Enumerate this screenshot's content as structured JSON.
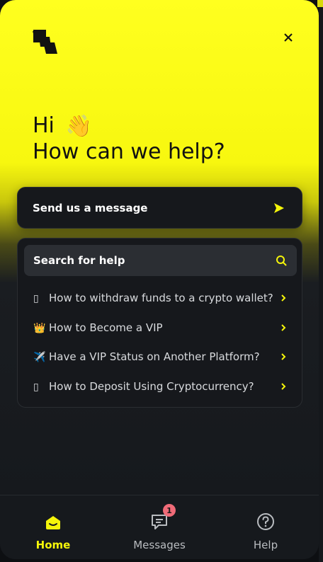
{
  "header": {
    "greeting_line1": "Hi",
    "greeting_emoji": "👋",
    "greeting_line2": "How can we help?",
    "logo_icon": "brand-logo-icon",
    "close_icon": "close-icon"
  },
  "send_message": {
    "label": "Send us a message",
    "icon": "send-arrow-icon"
  },
  "search": {
    "placeholder": "Search for help",
    "icon": "search-icon"
  },
  "articles": [
    {
      "emoji": "▯",
      "title": "How to withdraw funds to a crypto wallet?"
    },
    {
      "emoji": "👑",
      "title": "How to Become a VIP"
    },
    {
      "emoji": "✈️",
      "title": "Have a VIP Status on Another Platform?"
    },
    {
      "emoji": "▯",
      "title": "How to Deposit Using Cryptocurrency?"
    }
  ],
  "nav": {
    "home": {
      "label": "Home",
      "icon": "home-icon"
    },
    "messages": {
      "label": "Messages",
      "icon": "messages-icon",
      "badge": "1"
    },
    "help": {
      "label": "Help",
      "icon": "help-icon"
    }
  },
  "colors": {
    "accent": "#f5f50a",
    "background": "#16181c",
    "badge": "#f06b78"
  }
}
